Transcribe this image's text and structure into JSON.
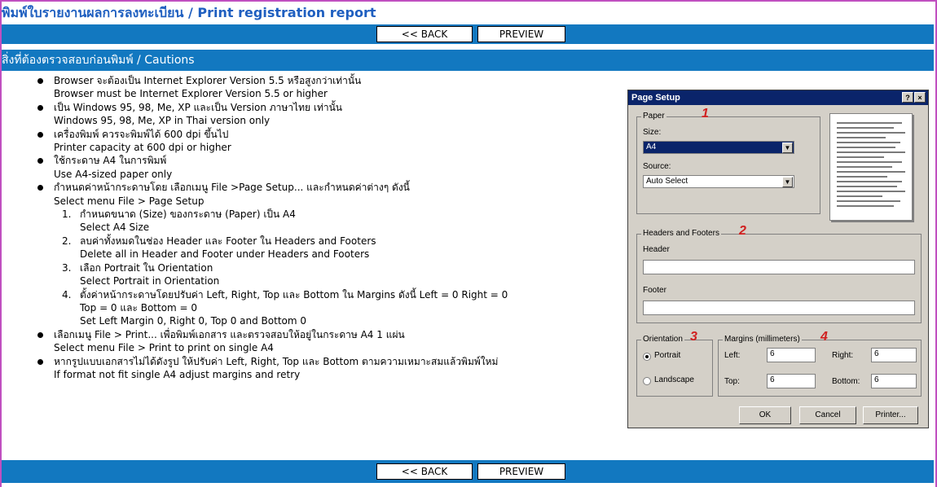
{
  "header": {
    "title": "พิมพ์ใบรายงานผลการลงทะเบียน / Print registration report",
    "back_label": "<< BACK",
    "preview_label": "PREVIEW"
  },
  "section": {
    "title": "สิ่งที่ต้องตรวจสอบก่อนพิมพ์ / Cautions"
  },
  "cautions": [
    {
      "th": "Browser จะต้องเป็น Internet Explorer Version 5.5 หรือสูงกว่าเท่านั้น",
      "en": "Browser must be Internet Explorer Version 5.5 or higher"
    },
    {
      "th": "เป็น Windows 95, 98, Me, XP และเป็น Version ภาษาไทย เท่านั้น",
      "en": "Windows 95, 98, Me, XP in Thai version only"
    },
    {
      "th": "เครื่องพิมพ์ ควรจะพิมพ์ได้ 600 dpi ขึ้นไป",
      "en": "Printer capacity at 600 dpi or higher"
    },
    {
      "th": "ใช้กระดาษ A4 ในการพิมพ์",
      "en": "Use A4-sized paper only"
    },
    {
      "th": "กำหนดค่าหน้ากระดาษโดย เลือกเมนู File >Page Setup... และกำหนดค่าต่างๆ ดังนี้",
      "en": "Select menu File > Page Setup"
    }
  ],
  "steps": [
    {
      "num": "1.",
      "th": "กำหนดขนาด (Size) ของกระดาษ (Paper) เป็น A4",
      "en": "Select A4 Size"
    },
    {
      "num": "2.",
      "th": "ลบค่าทั้งหมดในช่อง Header และ Footer ใน Headers and Footers",
      "en": "Delete all in Header and Footer under Headers and Footers"
    },
    {
      "num": "3.",
      "th": "เลือก Portrait ใน Orientation",
      "en": "Select Portrait in Orientation"
    },
    {
      "num": "4.",
      "th": "ตั้งค่าหน้ากระดาษโดยปรับค่า Left, Right, Top และ Bottom ใน Margins ดังนี้ Left = 0 Right = 0",
      "th2": "Top = 0 และ Bottom = 0",
      "en": "Set Left Margin 0, Right 0, Top 0 and Bottom 0"
    }
  ],
  "cautions_after": [
    {
      "th": "เลือกเมนู File > Print... เพื่อพิมพ์เอกสาร และตรวจสอบให้อยู่ในกระดาษ A4 1 แผ่น",
      "en": "Select menu File > Print to print on single A4"
    },
    {
      "th": "หากรูปแบบเอกสารไม่ได้ดังรูป ให้ปรับค่า Left, Right, Top และ Bottom ตามความเหมาะสมแล้วพิมพ์ใหม่",
      "en": "If format not fit single A4 adjust margins and retry"
    }
  ],
  "dialog": {
    "title": "Page Setup",
    "help": "?",
    "close": "×",
    "paper_label": "Paper",
    "size_label": "Size:",
    "size_value": "A4",
    "source_label": "Source:",
    "source_value": "Auto Select",
    "hf_label": "Headers and Footers",
    "header_label": "Header",
    "footer_label": "Footer",
    "orientation_label": "Orientation",
    "portrait_label": "Portrait",
    "landscape_label": "Landscape",
    "margins_label": "Margins (millimeters)",
    "left_label": "Left:",
    "right_label": "Right:",
    "top_label": "Top:",
    "bottom_label": "Bottom:",
    "left_value": "6",
    "right_value": "6",
    "top_value": "6",
    "bottom_value": "6",
    "ok_label": "OK",
    "cancel_label": "Cancel",
    "printer_label": "Printer...",
    "marks": [
      "1",
      "2",
      "3",
      "4"
    ]
  },
  "colors": {
    "bar": "#1278c0",
    "title": "#1f5fc0",
    "frame": "#c04fc0",
    "dialog_title": "#0a246a",
    "marker": "#d02020"
  }
}
